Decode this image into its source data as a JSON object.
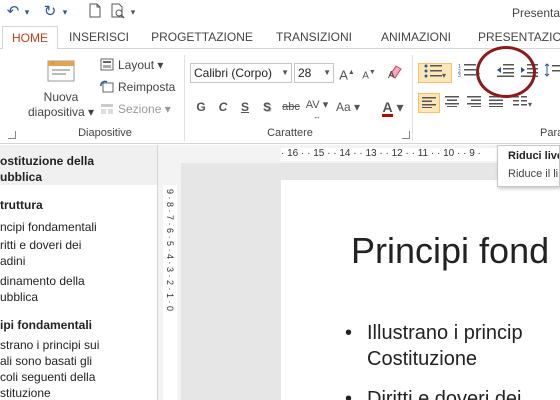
{
  "window": {
    "title": "Presenta"
  },
  "tabs": [
    "HOME",
    "INSERISCI",
    "PROGETTAZIONE",
    "TRANSIZIONI",
    "ANIMAZIONI",
    "PRESENTAZION"
  ],
  "ribbon": {
    "slides": {
      "new_slide": "Nuova",
      "new_slide2": "diapositiva",
      "layout": "Layout",
      "reset": "Reimposta",
      "section": "Sezione",
      "group_label": "Diapositive"
    },
    "font": {
      "font_name": "Calibri (Corpo)",
      "font_size": "28",
      "grow": "A",
      "shrink": "A",
      "bold": "G",
      "italic": "C",
      "underline": "S",
      "shadow": "S",
      "strike": "abc",
      "spacing": "AV",
      "case": "Aa",
      "color_a": "A",
      "group_label": "Carattere"
    },
    "paragraph": {
      "group_label": "Para"
    }
  },
  "tooltip": {
    "title": "Riduci live",
    "desc": "Riduce il li"
  },
  "outline": {
    "items": [
      {
        "text": "ostituzione della",
        "bold": true
      },
      {
        "text": "ubblica",
        "bold": true
      },
      {
        "text": "truttura",
        "bold": true
      },
      {
        "text": "ncipi fondamentali",
        "bold": false
      },
      {
        "text": "ritti e doveri dei",
        "bold": false
      },
      {
        "text": "adini",
        "bold": false
      },
      {
        "text": "dinamento della",
        "bold": false
      },
      {
        "text": "ubblica",
        "bold": false
      },
      {
        "text": "ipi fondamentali",
        "bold": true
      },
      {
        "text": "strano i principi sui",
        "bold": false
      },
      {
        "text": "ali sono basati gli",
        "bold": false
      },
      {
        "text": "coli seguenti della",
        "bold": false
      },
      {
        "text": "stituzione",
        "bold": false
      }
    ]
  },
  "ruler": {
    "marks": "· 16 · · 15 · · 14 · · 13 · · 12 · · 11 · · 10 · · 9 ·",
    "v_marks": "9 · 8 · 7 · 6 · 5 · 4 · 3 · 2 · 1 · 0"
  },
  "slide": {
    "title": "Principi fond",
    "bullets": [
      "Illustrano i princip",
      "Costituzione",
      "Diritti e doveri dei"
    ]
  },
  "colors": {
    "accent": "#c43e1c",
    "highlight": "#fde6b8",
    "circle": "#8b1a1a"
  }
}
